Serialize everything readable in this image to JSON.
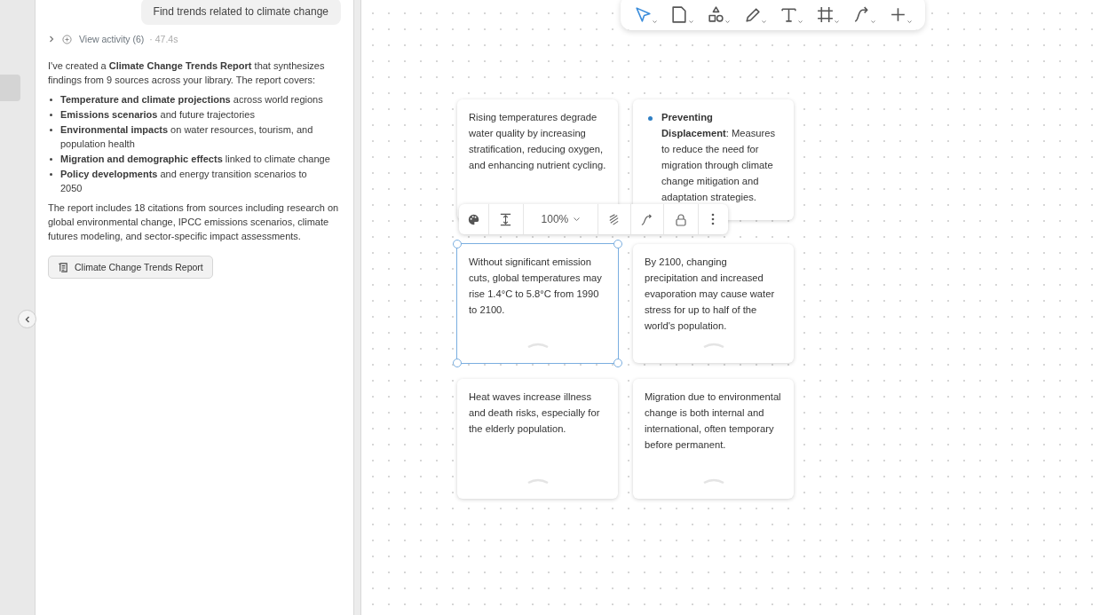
{
  "chat": {
    "user_message": "Find trends related to climate change",
    "activity": {
      "label": "View activity (6)",
      "time": "· 47.4s",
      "expanded": false
    },
    "intro": "I've created a **Climate Change Trends Report** that synthesizes findings from 9 sources across your library. The report covers:",
    "bullets": [
      "**Temperature and climate projections** across world regions",
      "**Emissions scenarios** and future trajectories",
      "**Environmental impacts** on water resources, tourism, and population health",
      "**Migration and demographic effects** linked to climate change",
      "**Policy developments** and energy transition scenarios to 2050"
    ],
    "closing": "The report includes 18 citations from sources including research on global environmental change, IPCC emissions scenarios, climate futures modeling, and sector-specific impact assessments.",
    "report_button": "Climate Change Trends Report"
  },
  "toolbar": [
    {
      "kind": "pointer",
      "selected": true
    },
    {
      "kind": "page",
      "selected": false
    },
    {
      "kind": "shapes",
      "selected": false
    },
    {
      "kind": "pen",
      "selected": false
    },
    {
      "kind": "text",
      "selected": false
    },
    {
      "kind": "frame",
      "selected": false
    },
    {
      "kind": "connector",
      "selected": false
    },
    {
      "kind": "add",
      "selected": false
    }
  ],
  "card_toolbar": {
    "zoom": "100%"
  },
  "cards": [
    {
      "kind": "text",
      "selected": false,
      "text": "Rising temperatures degrade water quality by increasing stratification, reducing oxygen, and enhancing nutrient cycling."
    },
    {
      "kind": "bullet",
      "selected": false,
      "color": "#2f7fc4",
      "text": "**Preventing Displacement**: Measures to reduce the need for migration through climate change mitigation and adaptation strategies."
    },
    {
      "kind": "text",
      "selected": true,
      "text": "Without significant emission cuts, global temperatures may rise 1.4°C to 5.8°C from 1990 to 2100."
    },
    {
      "kind": "text",
      "selected": false,
      "text": "By 2100, changing precipitation and increased evaporation may cause water stress for up to half of the world's population."
    },
    {
      "kind": "text",
      "selected": false,
      "text": "Heat waves increase illness and death risks, especially for the elderly population."
    },
    {
      "kind": "text",
      "selected": false,
      "text": "Migration due to environmental change is both internal and international, often temporary before permanent."
    }
  ]
}
